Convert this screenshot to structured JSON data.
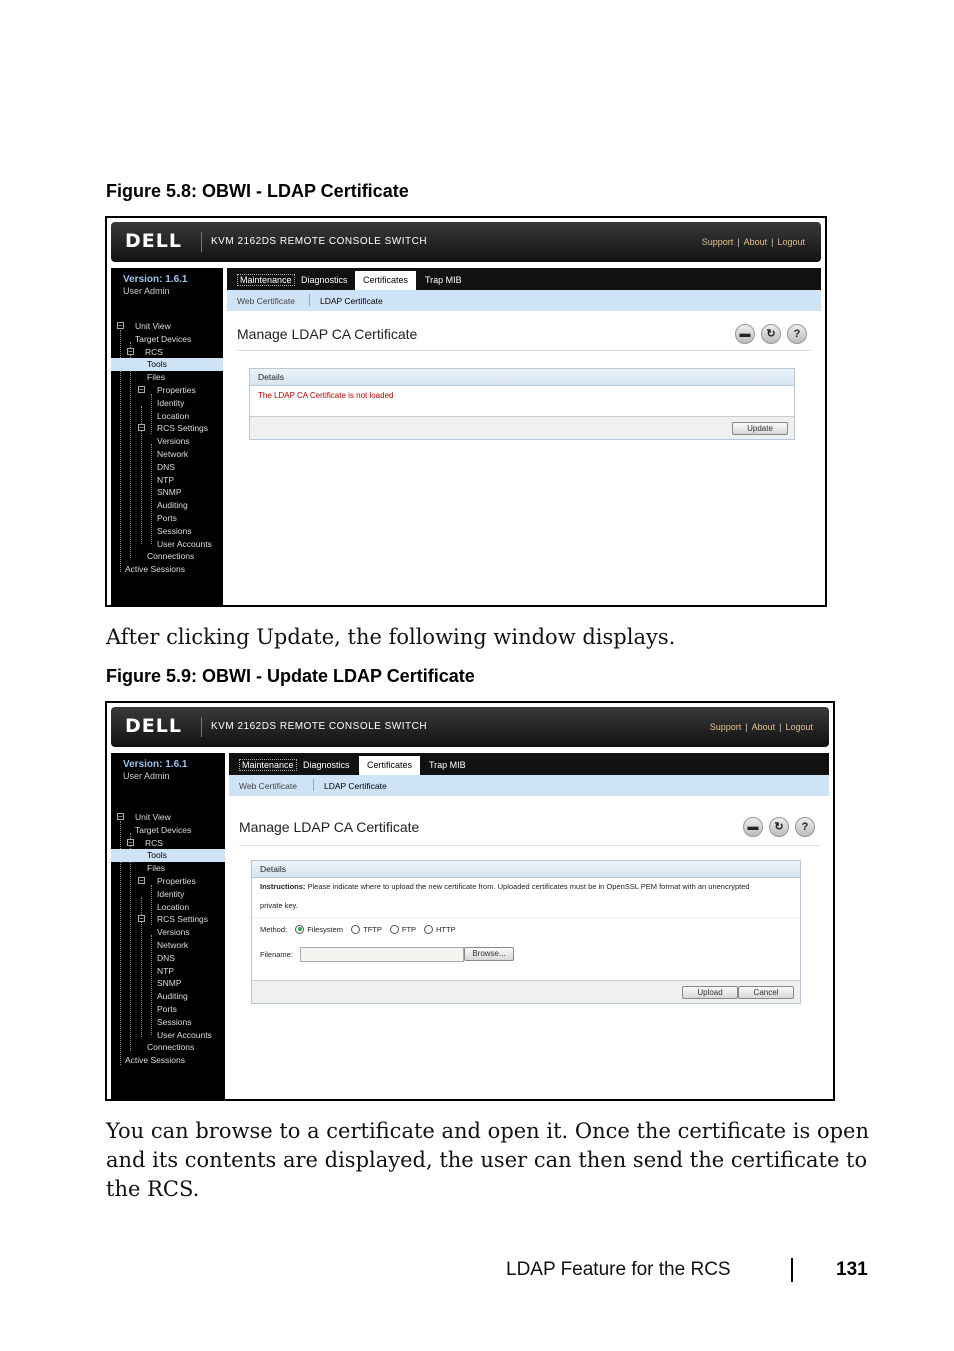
{
  "figure1": {
    "caption": "Figure 5.8: OBWI - LDAP Certificate"
  },
  "figure2": {
    "caption": "Figure 5.9: OBWI - Update LDAP Certificate"
  },
  "ui": {
    "logo": "DELL",
    "product": "KVM 2162DS REMOTE CONSOLE SWITCH",
    "links": {
      "support": "Support",
      "about": "About",
      "logout": "Logout"
    },
    "version": "Version: 1.6.1",
    "user": "User Admin",
    "tabs": [
      "Maintenance",
      "Diagnostics",
      "Certificates",
      "Trap MIB"
    ],
    "subtabs": [
      "Web Certificate",
      "LDAP Certificate"
    ],
    "tree": [
      "Unit View",
      "Target Devices",
      "RCS",
      "Tools",
      "Files",
      "Properties",
      "Identity",
      "Location",
      "RCS Settings",
      "Versions",
      "Network",
      "DNS",
      "NTP",
      "SNMP",
      "Auditing",
      "Ports",
      "Sessions",
      "User Accounts",
      "Connections",
      "Active Sessions"
    ],
    "page_title": "Manage LDAP CA Certificate",
    "toolbar_icons": [
      "print-icon",
      "refresh-icon",
      "help-icon"
    ],
    "details_label": "Details"
  },
  "screen1": {
    "status": "The LDAP CA Certificate is not loaded",
    "update_button": "Update"
  },
  "screen2": {
    "instructions_label": "Instructions:",
    "instructions_text": "Please indicate where to upload the new certificate from. Uploaded certificates must be in OpenSSL PEM format with an unencrypted",
    "instructions_text2": "private key.",
    "method_label": "Method:",
    "methods": [
      "Filesystem",
      "TFTP",
      "FTP",
      "HTTP"
    ],
    "filename_label": "Filename:",
    "browse_button": "Browse...",
    "upload_button": "Upload",
    "cancel_button": "Cancel"
  },
  "text1": "After clicking Update, the following window displays.",
  "text2": "You can browse to a certificate and open it. Once the certificate is open and its contents are displayed, the user can then send the certificate to the RCS.",
  "footer": {
    "section": "LDAP Feature for the RCS",
    "page": "131"
  }
}
